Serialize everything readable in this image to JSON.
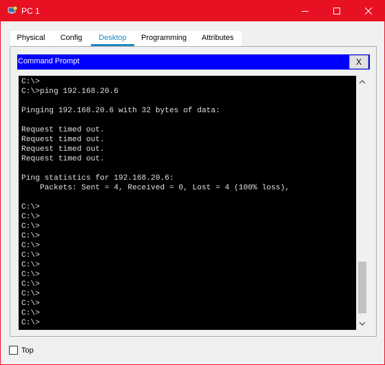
{
  "window": {
    "title": "PC 1",
    "title_bar_color": "#e81123",
    "icons": {
      "app": "cisco-pc-icon",
      "minimize": "minimize-icon",
      "maximize": "maximize-icon",
      "close": "close-icon"
    }
  },
  "tabs": [
    {
      "label": "Physical",
      "active": false
    },
    {
      "label": "Config",
      "active": false
    },
    {
      "label": "Desktop",
      "active": true
    },
    {
      "label": "Programming",
      "active": false
    },
    {
      "label": "Attributes",
      "active": false
    }
  ],
  "accent_color": "#1e88c8",
  "command_prompt": {
    "title": "Command Prompt",
    "close_label": "X",
    "title_bar_color": "#0000ff",
    "lines": [
      "C:\\>",
      "C:\\>ping 192.168.20.6",
      "",
      "Pinging 192.168.20.6 with 32 bytes of data:",
      "",
      "Request timed out.",
      "Request timed out.",
      "Request timed out.",
      "Request timed out.",
      "",
      "Ping statistics for 192.168.20.6:",
      "    Packets: Sent = 4, Received = 0, Lost = 4 (100% loss),",
      "",
      "C:\\>",
      "C:\\>",
      "C:\\>",
      "C:\\>",
      "C:\\>",
      "C:\\>",
      "C:\\>",
      "C:\\>",
      "C:\\>",
      "C:\\>",
      "C:\\>",
      "C:\\>",
      "C:\\>"
    ]
  },
  "footer": {
    "top_label": "Top",
    "top_checked": false
  }
}
